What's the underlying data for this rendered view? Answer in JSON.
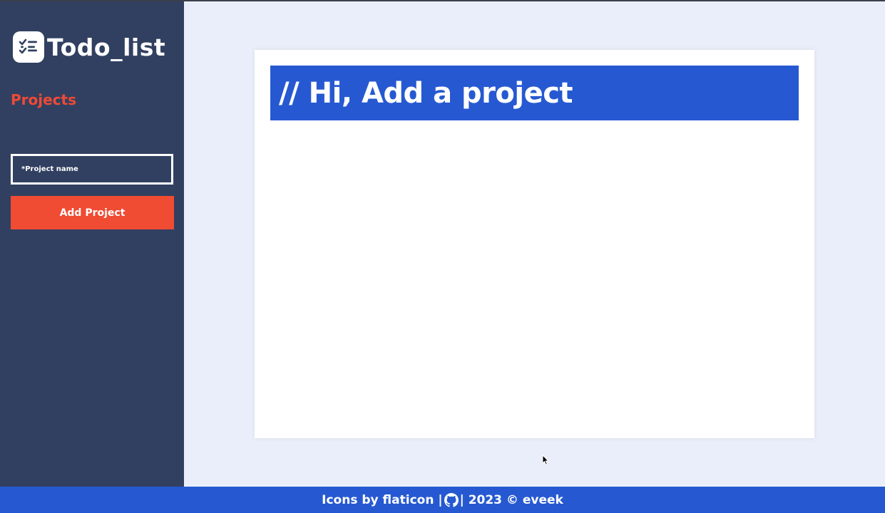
{
  "app": {
    "title": "Todo_list",
    "logo_icon": "checklist-icon"
  },
  "sidebar": {
    "projects_heading": "Projects",
    "project_input": {
      "placeholder": "*Project name",
      "value": ""
    },
    "add_button_label": "Add Project"
  },
  "main": {
    "banner_text": "// Hi, Add a project"
  },
  "footer": {
    "icons_text": "Icons by flaticon |",
    "github_icon": "github-icon",
    "copyright_text": "| 2023 © eveek"
  },
  "colors": {
    "sidebar_bg": "#314061",
    "accent_red": "#ef4a35",
    "brand_blue": "#2659d1",
    "page_bg": "#eaeefa"
  }
}
